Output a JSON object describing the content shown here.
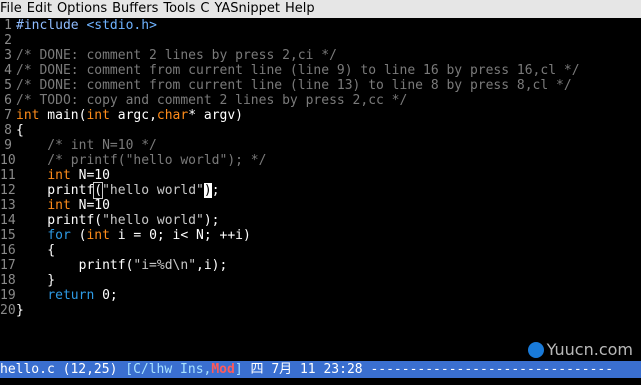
{
  "menubar": {
    "items": [
      "File",
      "Edit",
      "Options",
      "Buffers",
      "Tools",
      "C",
      "YASnippet",
      "Help"
    ]
  },
  "editor": {
    "lines": [
      {
        "n": "1",
        "parts": [
          {
            "t": "#include ",
            "c": "pp"
          },
          {
            "t": "<stdio.h>",
            "c": "inc"
          }
        ]
      },
      {
        "n": "2",
        "parts": []
      },
      {
        "n": "3",
        "parts": [
          {
            "t": "/* DONE: comment 2 lines by press 2,ci */",
            "c": "comment"
          }
        ]
      },
      {
        "n": "4",
        "parts": [
          {
            "t": "/* DONE: comment from current line (line 9) to line 16 by press 16,cl */",
            "c": "comment"
          }
        ]
      },
      {
        "n": "5",
        "parts": [
          {
            "t": "/* DONE: comment from current line (line 13) to line 8 by press 8,cl */",
            "c": "comment"
          }
        ]
      },
      {
        "n": "6",
        "parts": [
          {
            "t": "/* TODO: copy and comment 2 lines by press 2,cc */",
            "c": "comment"
          }
        ]
      },
      {
        "n": "7",
        "parts": [
          {
            "t": "int",
            "c": "kw"
          },
          {
            "t": " main(",
            "c": "fn"
          },
          {
            "t": "int",
            "c": "kw"
          },
          {
            "t": " argc,",
            "c": "fn"
          },
          {
            "t": "char",
            "c": "kw"
          },
          {
            "t": "* argv)",
            "c": "fn"
          }
        ]
      },
      {
        "n": "8",
        "parts": [
          {
            "t": "{",
            "c": "fn"
          }
        ]
      },
      {
        "n": "9",
        "parts": [
          {
            "t": "    /* int N=10 */",
            "c": "comment"
          }
        ]
      },
      {
        "n": "10",
        "parts": [
          {
            "t": "    /* printf(\"hello world\"); */",
            "c": "comment"
          }
        ]
      },
      {
        "n": "11",
        "parts": [
          {
            "t": "    ",
            "c": "fn"
          },
          {
            "t": "int",
            "c": "kw"
          },
          {
            "t": " N=10",
            "c": "fn"
          }
        ]
      },
      {
        "n": "12",
        "parts": [
          {
            "t": "    printf",
            "c": "fn"
          },
          {
            "t": "(",
            "c": "cursor-paren"
          },
          {
            "t": "\"hello world\"",
            "c": "str"
          },
          {
            "t": ")",
            "c": "cursor-box"
          },
          {
            "t": ";",
            "c": "fn"
          }
        ]
      },
      {
        "n": "13",
        "parts": [
          {
            "t": "    ",
            "c": "fn"
          },
          {
            "t": "int",
            "c": "kw"
          },
          {
            "t": " N=10",
            "c": "fn"
          }
        ]
      },
      {
        "n": "14",
        "parts": [
          {
            "t": "    printf(",
            "c": "fn"
          },
          {
            "t": "\"hello world\"",
            "c": "str"
          },
          {
            "t": ");",
            "c": "fn"
          }
        ]
      },
      {
        "n": "15",
        "parts": [
          {
            "t": "    ",
            "c": "fn"
          },
          {
            "t": "for",
            "c": "kw2"
          },
          {
            "t": " (",
            "c": "fn"
          },
          {
            "t": "int",
            "c": "kw"
          },
          {
            "t": " i = 0; i< N; ++i)",
            "c": "fn"
          }
        ]
      },
      {
        "n": "16",
        "parts": [
          {
            "t": "    {",
            "c": "fn"
          }
        ]
      },
      {
        "n": "17",
        "parts": [
          {
            "t": "        printf(",
            "c": "fn"
          },
          {
            "t": "\"i=%d\\n\"",
            "c": "str"
          },
          {
            "t": ",i);",
            "c": "fn"
          }
        ]
      },
      {
        "n": "18",
        "parts": [
          {
            "t": "    }",
            "c": "fn"
          }
        ]
      },
      {
        "n": "19",
        "parts": [
          {
            "t": "    ",
            "c": "fn"
          },
          {
            "t": "return",
            "c": "kw2"
          },
          {
            "t": " 0;",
            "c": "fn"
          }
        ]
      },
      {
        "n": "20",
        "parts": [
          {
            "t": "}",
            "c": "fn"
          }
        ]
      }
    ]
  },
  "modeline": {
    "buffer_name": "hello.c",
    "position": "(12,25)",
    "mode_open": "[C/lhw Ins,",
    "mode_mod": "Mod",
    "mode_close": "]",
    "input_method": "四",
    "datetime": "7月  11 23:28",
    "fill": "-------------------------------"
  },
  "watermark": {
    "text": "Yuucn.com"
  },
  "colors": {
    "menubar_bg": "#e6e6e6",
    "editor_bg": "#000000",
    "modeline_bg": "#3a6fd0",
    "keyword": "#ff8c1a",
    "comment": "#7a7a7a",
    "include": "#6fb3ff"
  }
}
